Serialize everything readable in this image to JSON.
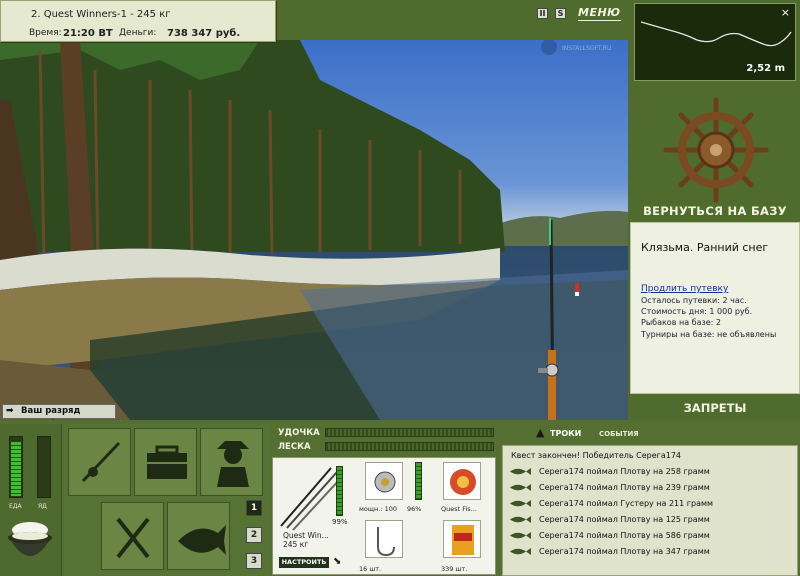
{
  "info": {
    "quest": "2. Quest Winners-1 - 245 кг",
    "time_label": "Время:",
    "time_value": "21:20 ВТ",
    "money_label": "Деньги:",
    "money_value": "738 347 руб."
  },
  "controls": {
    "pause": "II",
    "sound": "S",
    "menu": "МЕНЮ"
  },
  "depth": {
    "close": "×",
    "value": "2,52 m"
  },
  "rank_message": "Ваш разряд вырос!",
  "watermark": "INSTALLSOFT.RU",
  "base": {
    "return_label": "ВЕРНУТЬСЯ НА БАЗУ",
    "location": "Клязьма. Ранний снег",
    "renew_link": "Продлить путевку",
    "stats": [
      "Осталось путевки: 2 час.",
      "Стоимость дня: 1 000 руб.",
      "Рыбаков на базе: 2",
      "Турниры на базе: не объявлены"
    ],
    "bans_label": "ЗАПРЕТЫ"
  },
  "food": {
    "eat_label": "ЕДА",
    "poison_label": "ЯД",
    "eat_level": 0.9,
    "poison_level": 0.0
  },
  "slots": [
    "1",
    "2",
    "3"
  ],
  "gauges": {
    "rod_label": "УДОЧКА",
    "line_label": "ЛЕСКА"
  },
  "tackle": {
    "rod_name": "Quest Win...",
    "rod_weight": "245 кг",
    "rod_pct": "99%",
    "reel_label": "мощн.: 100",
    "reel_pct": "96%",
    "line_label": "Quest Fis...",
    "hook_label": "16 шт.",
    "bait_label": "339 шт.",
    "setup_button": "НАСТРОИТЬ"
  },
  "tabs": {
    "chat": "ТРОКИ",
    "events": "СОБЫТИЯ"
  },
  "events": [
    "Квест закончен! Победитель Серега174",
    "Серега174 поймал Плотву на 258 грамм",
    "Серега174 поймал Плотву на 239 грамм",
    "Серега174 поймал Густеру на 211 грамм",
    "Серега174 поймал Плотву на 125 грамм",
    "Серега174 поймал Плотву на 586 грамм",
    "Серега174 поймал Плотву на 347 грамм"
  ]
}
